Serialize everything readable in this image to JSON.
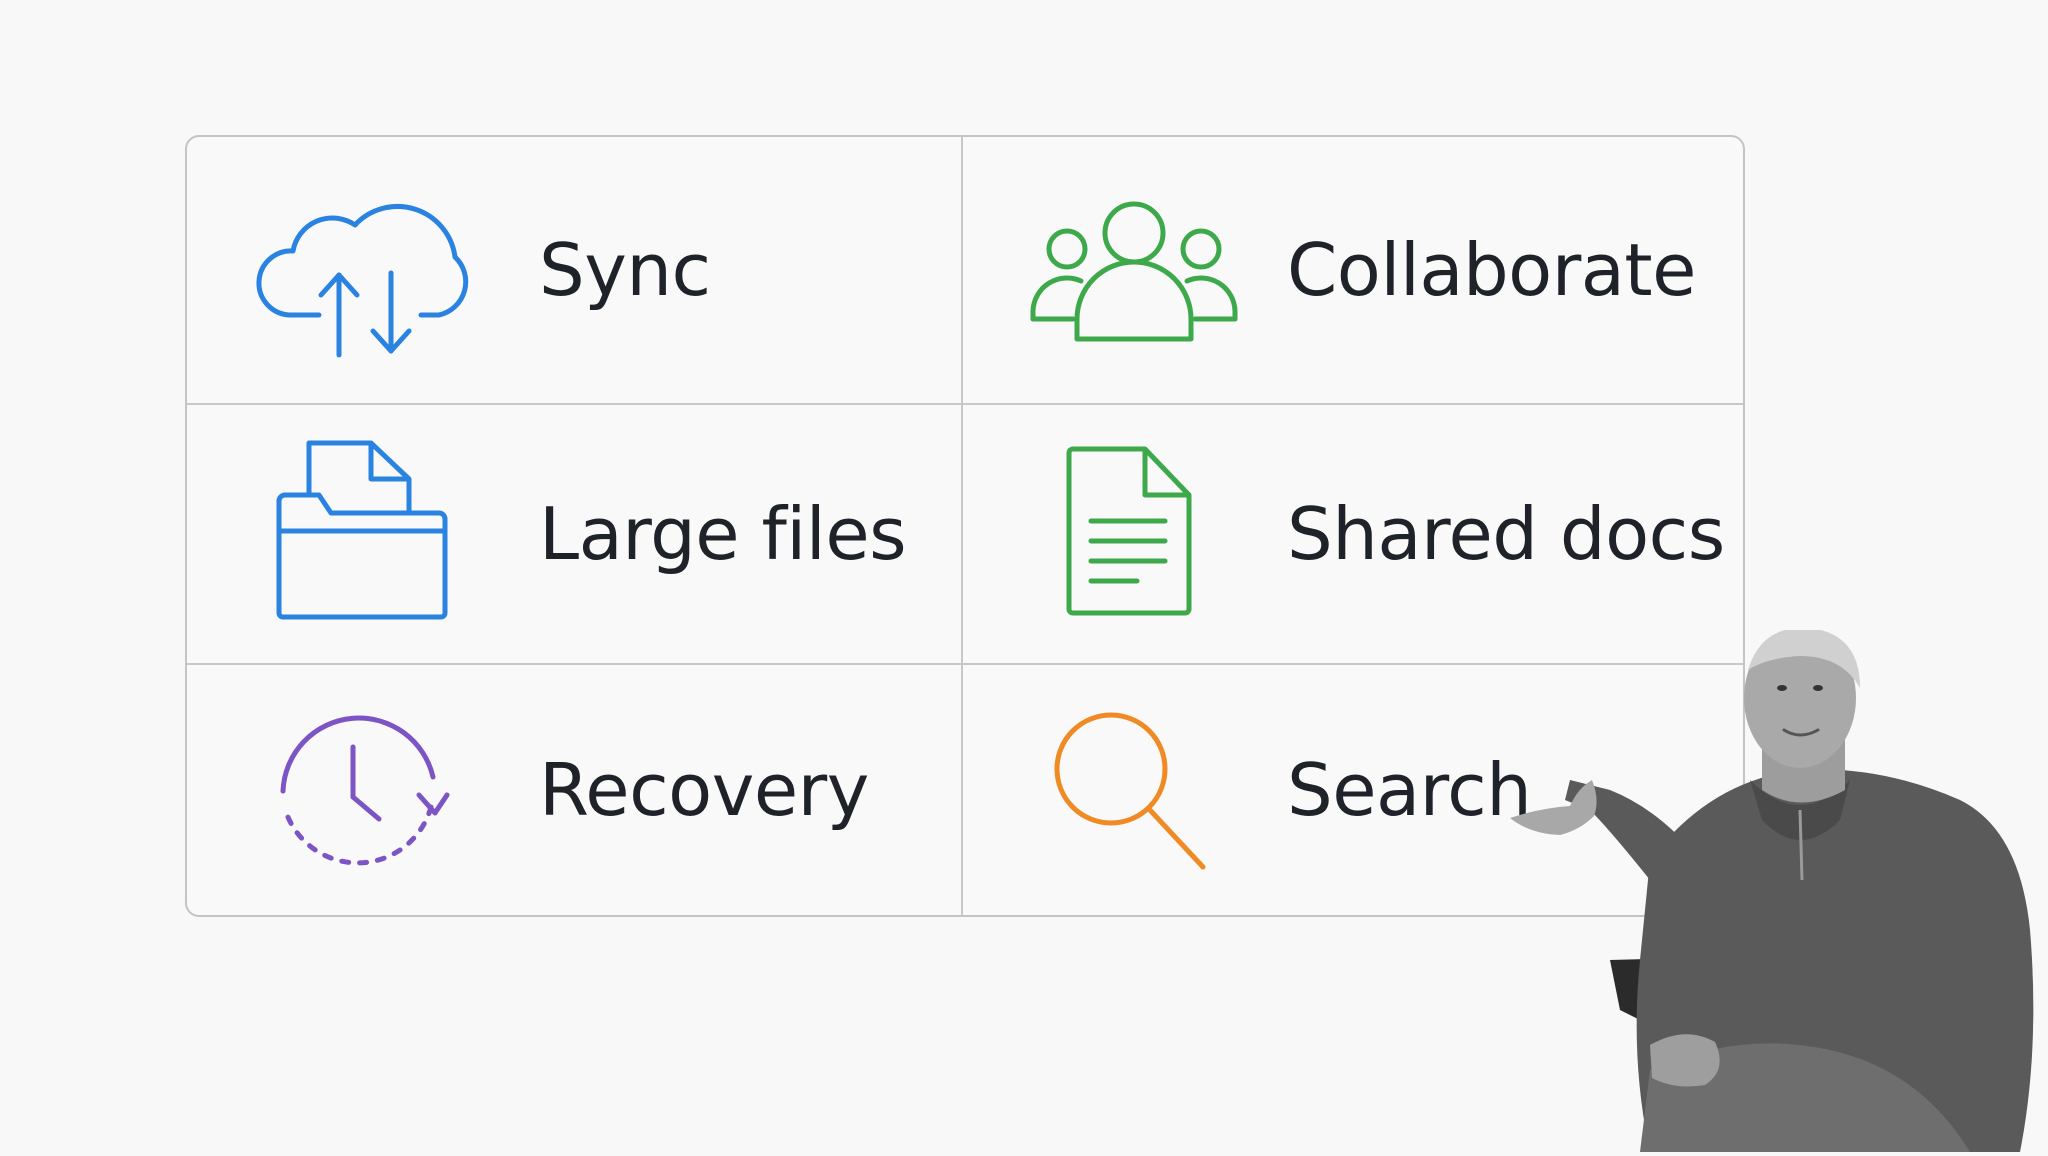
{
  "features": {
    "sync": {
      "label": "Sync",
      "icon": "cloud-sync-icon",
      "color": "#2a83e0"
    },
    "collaborate": {
      "label": "Collaborate",
      "icon": "people-group-icon",
      "color": "#3da94a"
    },
    "large_files": {
      "label": "Large files",
      "icon": "folder-file-icon",
      "color": "#2a83e0"
    },
    "shared_docs": {
      "label": "Shared docs",
      "icon": "document-icon",
      "color": "#3da94a"
    },
    "recovery": {
      "label": "Recovery",
      "icon": "clock-history-icon",
      "color": "#7d54c4"
    },
    "search": {
      "label": "Search",
      "icon": "magnifier-icon",
      "color": "#f08a24"
    }
  },
  "presenter": {
    "description_icon": "presenter-icon"
  }
}
